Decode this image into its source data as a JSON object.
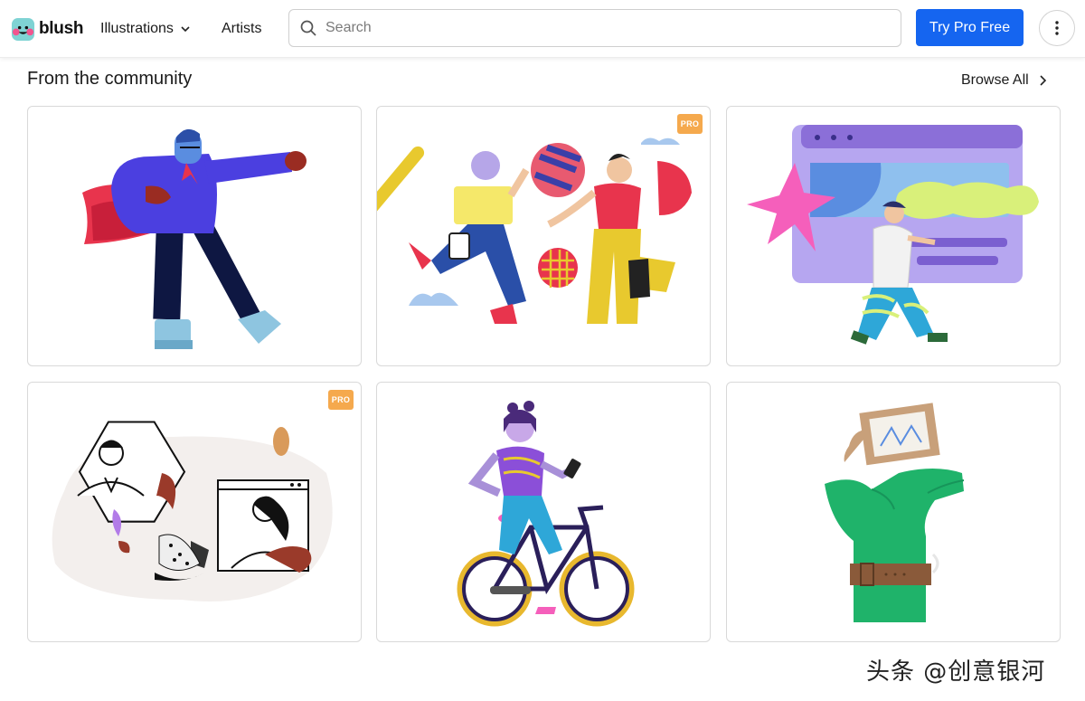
{
  "header": {
    "logo_text": "blush",
    "nav": [
      {
        "label": "Illustrations",
        "has_dropdown": true
      },
      {
        "label": "Artists",
        "has_dropdown": false
      }
    ],
    "search": {
      "placeholder": "Search",
      "value": ""
    },
    "pro_button": "Try Pro Free",
    "more_icon": "more-vertical-icon"
  },
  "section": {
    "title": "From the community",
    "browse_all": "Browse All"
  },
  "cards": [
    {
      "id": "superhero-man",
      "pro": false
    },
    {
      "id": "shopping-friends",
      "pro": true
    },
    {
      "id": "web-designer",
      "pro": false
    },
    {
      "id": "yoga-video-call",
      "pro": true
    },
    {
      "id": "girl-bicycle",
      "pro": false
    },
    {
      "id": "hand-holding-frame",
      "pro": false
    }
  ],
  "badge_label": "PRO",
  "watermark": "头条 @创意银河",
  "colors": {
    "accent": "#1565f0",
    "pro_badge": "#f5a94d"
  }
}
